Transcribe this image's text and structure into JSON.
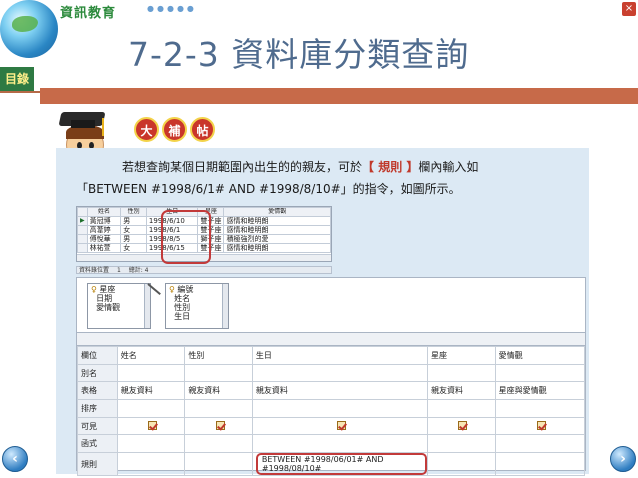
{
  "header": {
    "brand": "資訊教育",
    "brand_dots": "●●●●●",
    "close": "×",
    "title": "7-2-3 資料庫分類查詢",
    "toc_tab": "目錄"
  },
  "badges": [
    "大",
    "補",
    "帖"
  ],
  "description": {
    "line1_prefix": "若想查詢某個日期範圍內出生的的親友，可於",
    "line1_rule": "【 規則 】",
    "line1_suffix": "欄內輸入如",
    "line2": "「BETWEEN #1998/6/1# AND #1998/8/10#」的指令，如圖所示。"
  },
  "datasheet": {
    "columns": [
      "姓名",
      "性別",
      "生日",
      "星座",
      "愛情觀"
    ],
    "rows": [
      {
        "selector": "▶",
        "name": "黃冠博",
        "gender": "男",
        "birthday": "1998/6/10",
        "sign": "雙子座",
        "love": "感情和睦明朗"
      },
      {
        "selector": "",
        "name": "高葦婷",
        "gender": "女",
        "birthday": "1998/6/1",
        "sign": "雙子座",
        "love": "感情和睦明朗"
      },
      {
        "selector": "",
        "name": "傅悅華",
        "gender": "男",
        "birthday": "1998/8/5",
        "sign": "獅子座",
        "love": "積極強烈的愛"
      },
      {
        "selector": "",
        "name": "林祐萱",
        "gender": "女",
        "birthday": "1998/6/15",
        "sign": "雙子座",
        "love": "感情和睦明朗"
      }
    ],
    "nav": {
      "label": "資料錄位置",
      "current": "1",
      "total_label": "總計: 4"
    }
  },
  "tables": [
    {
      "fields": [
        "星座",
        "日期",
        "愛情觀"
      ]
    },
    {
      "fields": [
        "編號",
        "姓名",
        "性別",
        "生日"
      ]
    }
  ],
  "grid": {
    "row_labels": [
      "欄位",
      "別名",
      "表格",
      "排序",
      "可見",
      "函式",
      "規則"
    ],
    "fields": [
      "姓名",
      "性別",
      "生日",
      "星座",
      "愛情觀"
    ],
    "tables": [
      "親友資料",
      "親友資料",
      "親友資料",
      "親友資料",
      "星座與愛情觀"
    ],
    "criteria": "BETWEEN #1998/06/01# AND #1998/08/10#"
  },
  "nav_buttons": {
    "prev": "‹",
    "next": "›"
  }
}
